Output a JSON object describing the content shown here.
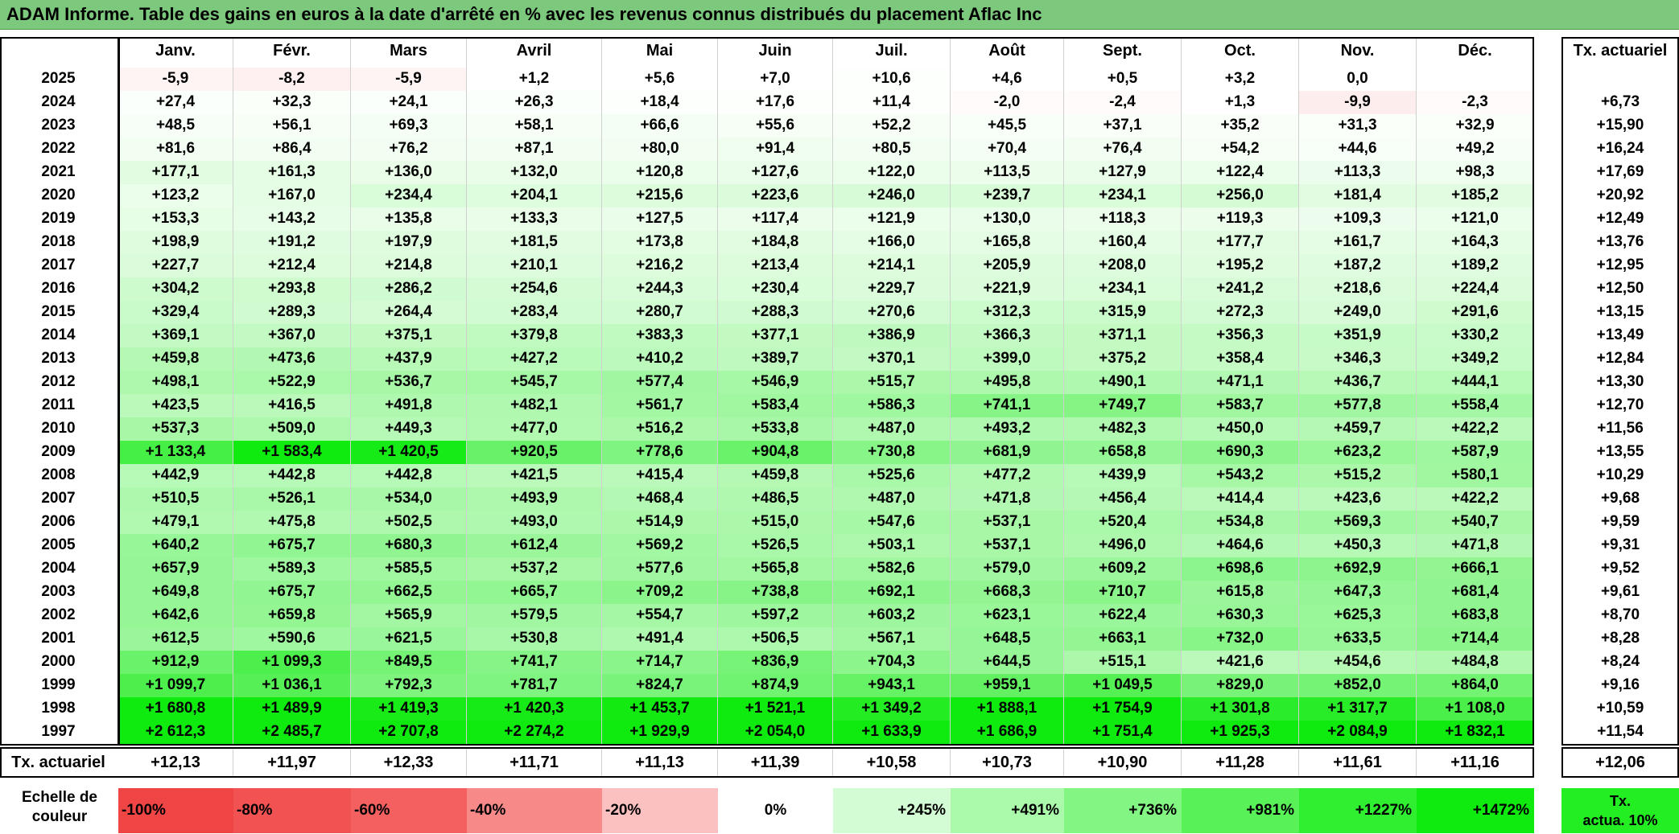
{
  "title": "ADAM Informe. Table des gains en euros à la date d'arrêté en % avec les revenus connus distribués du placement Aflac Inc",
  "chart_data": {
    "type": "table",
    "columns": [
      "Janv.",
      "Févr.",
      "Mars",
      "Avril",
      "Mai",
      "Juin",
      "Juil.",
      "Août",
      "Sept.",
      "Oct.",
      "Nov.",
      "Déc."
    ],
    "rate_header": "Tx. actuariel",
    "rows": [
      {
        "year": "2025",
        "values": [
          "-5,9",
          "-8,2",
          "-5,9",
          "+1,2",
          "+5,6",
          "+7,0",
          "+10,6",
          "+4,6",
          "+0,5",
          "+3,2",
          "0,0",
          ""
        ],
        "nums": [
          -5.9,
          -8.2,
          -5.9,
          1.2,
          5.6,
          7.0,
          10.6,
          4.6,
          0.5,
          3.2,
          0,
          null
        ],
        "rate": ""
      },
      {
        "year": "2024",
        "values": [
          "+27,4",
          "+32,3",
          "+24,1",
          "+26,3",
          "+18,4",
          "+17,6",
          "+11,4",
          "-2,0",
          "-2,4",
          "+1,3",
          "-9,9",
          "-2,3"
        ],
        "nums": [
          27.4,
          32.3,
          24.1,
          26.3,
          18.4,
          17.6,
          11.4,
          -2.0,
          -2.4,
          1.3,
          -9.9,
          -2.3
        ],
        "rate": "+6,73"
      },
      {
        "year": "2023",
        "values": [
          "+48,5",
          "+56,1",
          "+69,3",
          "+58,1",
          "+66,6",
          "+55,6",
          "+52,2",
          "+45,5",
          "+37,1",
          "+35,2",
          "+31,3",
          "+32,9"
        ],
        "nums": [
          48.5,
          56.1,
          69.3,
          58.1,
          66.6,
          55.6,
          52.2,
          45.5,
          37.1,
          35.2,
          31.3,
          32.9
        ],
        "rate": "+15,90"
      },
      {
        "year": "2022",
        "values": [
          "+81,6",
          "+86,4",
          "+76,2",
          "+87,1",
          "+80,0",
          "+91,4",
          "+80,5",
          "+70,4",
          "+76,4",
          "+54,2",
          "+44,6",
          "+49,2"
        ],
        "nums": [
          81.6,
          86.4,
          76.2,
          87.1,
          80.0,
          91.4,
          80.5,
          70.4,
          76.4,
          54.2,
          44.6,
          49.2
        ],
        "rate": "+16,24"
      },
      {
        "year": "2021",
        "values": [
          "+177,1",
          "+161,3",
          "+136,0",
          "+132,0",
          "+120,8",
          "+127,6",
          "+122,0",
          "+113,5",
          "+127,9",
          "+122,4",
          "+113,3",
          "+98,3"
        ],
        "nums": [
          177.1,
          161.3,
          136.0,
          132.0,
          120.8,
          127.6,
          122.0,
          113.5,
          127.9,
          122.4,
          113.3,
          98.3
        ],
        "rate": "+17,69"
      },
      {
        "year": "2020",
        "values": [
          "+123,2",
          "+167,0",
          "+234,4",
          "+204,1",
          "+215,6",
          "+223,6",
          "+246,0",
          "+239,7",
          "+234,1",
          "+256,0",
          "+181,4",
          "+185,2"
        ],
        "nums": [
          123.2,
          167.0,
          234.4,
          204.1,
          215.6,
          223.6,
          246.0,
          239.7,
          234.1,
          256.0,
          181.4,
          185.2
        ],
        "rate": "+20,92"
      },
      {
        "year": "2019",
        "values": [
          "+153,3",
          "+143,2",
          "+135,8",
          "+133,3",
          "+127,5",
          "+117,4",
          "+121,9",
          "+130,0",
          "+118,3",
          "+119,3",
          "+109,3",
          "+121,0"
        ],
        "nums": [
          153.3,
          143.2,
          135.8,
          133.3,
          127.5,
          117.4,
          121.9,
          130.0,
          118.3,
          119.3,
          109.3,
          121.0
        ],
        "rate": "+12,49"
      },
      {
        "year": "2018",
        "values": [
          "+198,9",
          "+191,2",
          "+197,9",
          "+181,5",
          "+173,8",
          "+184,8",
          "+166,0",
          "+165,8",
          "+160,4",
          "+177,7",
          "+161,7",
          "+164,3"
        ],
        "nums": [
          198.9,
          191.2,
          197.9,
          181.5,
          173.8,
          184.8,
          166.0,
          165.8,
          160.4,
          177.7,
          161.7,
          164.3
        ],
        "rate": "+13,76"
      },
      {
        "year": "2017",
        "values": [
          "+227,7",
          "+212,4",
          "+214,8",
          "+210,1",
          "+216,2",
          "+213,4",
          "+214,1",
          "+205,9",
          "+208,0",
          "+195,2",
          "+187,2",
          "+189,2"
        ],
        "nums": [
          227.7,
          212.4,
          214.8,
          210.1,
          216.2,
          213.4,
          214.1,
          205.9,
          208.0,
          195.2,
          187.2,
          189.2
        ],
        "rate": "+12,95"
      },
      {
        "year": "2016",
        "values": [
          "+304,2",
          "+293,8",
          "+286,2",
          "+254,6",
          "+244,3",
          "+230,4",
          "+229,7",
          "+221,9",
          "+234,1",
          "+241,2",
          "+218,6",
          "+224,4"
        ],
        "nums": [
          304.2,
          293.8,
          286.2,
          254.6,
          244.3,
          230.4,
          229.7,
          221.9,
          234.1,
          241.2,
          218.6,
          224.4
        ],
        "rate": "+12,50"
      },
      {
        "year": "2015",
        "values": [
          "+329,4",
          "+289,3",
          "+264,4",
          "+283,4",
          "+280,7",
          "+288,3",
          "+270,6",
          "+312,3",
          "+315,9",
          "+272,3",
          "+249,0",
          "+291,6"
        ],
        "nums": [
          329.4,
          289.3,
          264.4,
          283.4,
          280.7,
          288.3,
          270.6,
          312.3,
          315.9,
          272.3,
          249.0,
          291.6
        ],
        "rate": "+13,15"
      },
      {
        "year": "2014",
        "values": [
          "+369,1",
          "+367,0",
          "+375,1",
          "+379,8",
          "+383,3",
          "+377,1",
          "+386,9",
          "+366,3",
          "+371,1",
          "+356,3",
          "+351,9",
          "+330,2"
        ],
        "nums": [
          369.1,
          367.0,
          375.1,
          379.8,
          383.3,
          377.1,
          386.9,
          366.3,
          371.1,
          356.3,
          351.9,
          330.2
        ],
        "rate": "+13,49"
      },
      {
        "year": "2013",
        "values": [
          "+459,8",
          "+473,6",
          "+437,9",
          "+427,2",
          "+410,2",
          "+389,7",
          "+370,1",
          "+399,0",
          "+375,2",
          "+358,4",
          "+346,3",
          "+349,2"
        ],
        "nums": [
          459.8,
          473.6,
          437.9,
          427.2,
          410.2,
          389.7,
          370.1,
          399.0,
          375.2,
          358.4,
          346.3,
          349.2
        ],
        "rate": "+12,84"
      },
      {
        "year": "2012",
        "values": [
          "+498,1",
          "+522,9",
          "+536,7",
          "+545,7",
          "+577,4",
          "+546,9",
          "+515,7",
          "+495,8",
          "+490,1",
          "+471,1",
          "+436,7",
          "+444,1"
        ],
        "nums": [
          498.1,
          522.9,
          536.7,
          545.7,
          577.4,
          546.9,
          515.7,
          495.8,
          490.1,
          471.1,
          436.7,
          444.1
        ],
        "rate": "+13,30"
      },
      {
        "year": "2011",
        "values": [
          "+423,5",
          "+416,5",
          "+491,8",
          "+482,1",
          "+561,7",
          "+583,4",
          "+586,3",
          "+741,1",
          "+749,7",
          "+583,7",
          "+577,8",
          "+558,4"
        ],
        "nums": [
          423.5,
          416.5,
          491.8,
          482.1,
          561.7,
          583.4,
          586.3,
          741.1,
          749.7,
          583.7,
          577.8,
          558.4
        ],
        "rate": "+12,70"
      },
      {
        "year": "2010",
        "values": [
          "+537,3",
          "+509,0",
          "+449,3",
          "+477,0",
          "+516,2",
          "+533,8",
          "+487,0",
          "+493,2",
          "+482,3",
          "+450,0",
          "+459,7",
          "+422,2"
        ],
        "nums": [
          537.3,
          509.0,
          449.3,
          477.0,
          516.2,
          533.8,
          487.0,
          493.2,
          482.3,
          450.0,
          459.7,
          422.2
        ],
        "rate": "+11,56"
      },
      {
        "year": "2009",
        "values": [
          "+1 133,4",
          "+1 583,4",
          "+1 420,5",
          "+920,5",
          "+778,6",
          "+904,8",
          "+730,8",
          "+681,9",
          "+658,8",
          "+690,3",
          "+623,2",
          "+587,9"
        ],
        "nums": [
          1133.4,
          1583.4,
          1420.5,
          920.5,
          778.6,
          904.8,
          730.8,
          681.9,
          658.8,
          690.3,
          623.2,
          587.9
        ],
        "rate": "+13,55"
      },
      {
        "year": "2008",
        "values": [
          "+442,9",
          "+442,8",
          "+442,8",
          "+421,5",
          "+415,4",
          "+459,8",
          "+525,6",
          "+477,2",
          "+439,9",
          "+543,2",
          "+515,2",
          "+580,1"
        ],
        "nums": [
          442.9,
          442.8,
          442.8,
          421.5,
          415.4,
          459.8,
          525.6,
          477.2,
          439.9,
          543.2,
          515.2,
          580.1
        ],
        "rate": "+10,29"
      },
      {
        "year": "2007",
        "values": [
          "+510,5",
          "+526,1",
          "+534,0",
          "+493,9",
          "+468,4",
          "+486,5",
          "+487,0",
          "+471,8",
          "+456,4",
          "+414,4",
          "+423,6",
          "+422,2"
        ],
        "nums": [
          510.5,
          526.1,
          534.0,
          493.9,
          468.4,
          486.5,
          487.0,
          471.8,
          456.4,
          414.4,
          423.6,
          422.2
        ],
        "rate": "+9,68"
      },
      {
        "year": "2006",
        "values": [
          "+479,1",
          "+475,8",
          "+502,5",
          "+493,0",
          "+514,9",
          "+515,0",
          "+547,6",
          "+537,1",
          "+520,4",
          "+534,8",
          "+569,3",
          "+540,7"
        ],
        "nums": [
          479.1,
          475.8,
          502.5,
          493.0,
          514.9,
          515.0,
          547.6,
          537.1,
          520.4,
          534.8,
          569.3,
          540.7
        ],
        "rate": "+9,59"
      },
      {
        "year": "2005",
        "values": [
          "+640,2",
          "+675,7",
          "+680,3",
          "+612,4",
          "+569,2",
          "+526,5",
          "+503,1",
          "+537,1",
          "+496,0",
          "+464,6",
          "+450,3",
          "+471,8"
        ],
        "nums": [
          640.2,
          675.7,
          680.3,
          612.4,
          569.2,
          526.5,
          503.1,
          537.1,
          496.0,
          464.6,
          450.3,
          471.8
        ],
        "rate": "+9,31"
      },
      {
        "year": "2004",
        "values": [
          "+657,9",
          "+589,3",
          "+585,5",
          "+537,2",
          "+577,6",
          "+565,8",
          "+582,6",
          "+579,0",
          "+609,2",
          "+698,6",
          "+692,9",
          "+666,1"
        ],
        "nums": [
          657.9,
          589.3,
          585.5,
          537.2,
          577.6,
          565.8,
          582.6,
          579.0,
          609.2,
          698.6,
          692.9,
          666.1
        ],
        "rate": "+9,52"
      },
      {
        "year": "2003",
        "values": [
          "+649,8",
          "+675,7",
          "+662,5",
          "+665,7",
          "+709,2",
          "+738,8",
          "+692,1",
          "+668,3",
          "+710,7",
          "+615,8",
          "+647,3",
          "+681,4"
        ],
        "nums": [
          649.8,
          675.7,
          662.5,
          665.7,
          709.2,
          738.8,
          692.1,
          668.3,
          710.7,
          615.8,
          647.3,
          681.4
        ],
        "rate": "+9,61"
      },
      {
        "year": "2002",
        "values": [
          "+642,6",
          "+659,8",
          "+565,9",
          "+579,5",
          "+554,7",
          "+597,2",
          "+603,2",
          "+623,1",
          "+622,4",
          "+630,3",
          "+625,3",
          "+683,8"
        ],
        "nums": [
          642.6,
          659.8,
          565.9,
          579.5,
          554.7,
          597.2,
          603.2,
          623.1,
          622.4,
          630.3,
          625.3,
          683.8
        ],
        "rate": "+8,70"
      },
      {
        "year": "2001",
        "values": [
          "+612,5",
          "+590,6",
          "+621,5",
          "+530,8",
          "+491,4",
          "+506,5",
          "+567,1",
          "+648,5",
          "+663,1",
          "+732,0",
          "+633,5",
          "+714,4"
        ],
        "nums": [
          612.5,
          590.6,
          621.5,
          530.8,
          491.4,
          506.5,
          567.1,
          648.5,
          663.1,
          732.0,
          633.5,
          714.4
        ],
        "rate": "+8,28"
      },
      {
        "year": "2000",
        "values": [
          "+912,9",
          "+1 099,3",
          "+849,5",
          "+741,7",
          "+714,7",
          "+836,9",
          "+704,3",
          "+644,5",
          "+515,1",
          "+421,6",
          "+454,6",
          "+484,8"
        ],
        "nums": [
          912.9,
          1099.3,
          849.5,
          741.7,
          714.7,
          836.9,
          704.3,
          644.5,
          515.1,
          421.6,
          454.6,
          484.8
        ],
        "rate": "+8,24"
      },
      {
        "year": "1999",
        "values": [
          "+1 099,7",
          "+1 036,1",
          "+792,3",
          "+781,7",
          "+824,7",
          "+874,9",
          "+943,1",
          "+959,1",
          "+1 049,5",
          "+829,0",
          "+852,0",
          "+864,0"
        ],
        "nums": [
          1099.7,
          1036.1,
          792.3,
          781.7,
          824.7,
          874.9,
          943.1,
          959.1,
          1049.5,
          829.0,
          852.0,
          864.0
        ],
        "rate": "+9,16"
      },
      {
        "year": "1998",
        "values": [
          "+1 680,8",
          "+1 489,9",
          "+1 419,3",
          "+1 420,3",
          "+1 453,7",
          "+1 521,1",
          "+1 349,2",
          "+1 888,1",
          "+1 754,9",
          "+1 301,8",
          "+1 317,7",
          "+1 108,0"
        ],
        "nums": [
          1680.8,
          1489.9,
          1419.3,
          1420.3,
          1453.7,
          1521.1,
          1349.2,
          1888.1,
          1754.9,
          1301.8,
          1317.7,
          1108.0
        ],
        "rate": "+10,59"
      },
      {
        "year": "1997",
        "values": [
          "+2 612,3",
          "+2 485,7",
          "+2 707,8",
          "+2 274,2",
          "+1 929,9",
          "+2 054,0",
          "+1 633,9",
          "+1 686,9",
          "+1 751,4",
          "+1 925,3",
          "+2 084,9",
          "+1 832,1"
        ],
        "nums": [
          2612.3,
          2485.7,
          2707.8,
          2274.2,
          1929.9,
          2054.0,
          1633.9,
          1686.9,
          1751.4,
          1925.3,
          2084.9,
          1832.1
        ],
        "rate": "+11,54"
      }
    ],
    "footer": {
      "label": "Tx. actuariel",
      "values": [
        "+12,13",
        "+11,97",
        "+12,33",
        "+11,71",
        "+11,13",
        "+11,39",
        "+10,58",
        "+10,73",
        "+10,90",
        "+11,28",
        "+11,61",
        "+11,16"
      ],
      "overall": "+12,06"
    },
    "legend": {
      "label_line1": "Echelle de",
      "label_line2": "couleur",
      "items": [
        {
          "text": "-100%",
          "color": "#f04545"
        },
        {
          "text": "-80%",
          "color": "#f25252"
        },
        {
          "text": "-60%",
          "color": "#f46060"
        },
        {
          "text": "-40%",
          "color": "#f78989"
        },
        {
          "text": "-20%",
          "color": "#fbc0c0"
        },
        {
          "text": "0%",
          "color": "#ffffff"
        },
        {
          "text": "+245%",
          "color": "#d4fcd4"
        },
        {
          "text": "+491%",
          "color": "#abf9ab"
        },
        {
          "text": "+736%",
          "color": "#82f582"
        },
        {
          "text": "+981%",
          "color": "#58f258"
        },
        {
          "text": "+1227%",
          "color": "#30ee30"
        },
        {
          "text": "+1472%",
          "color": "#0fea0f"
        }
      ],
      "final_line1": "Tx.",
      "final_line2": "actua. 10%",
      "final_color": "#22ee22"
    }
  }
}
